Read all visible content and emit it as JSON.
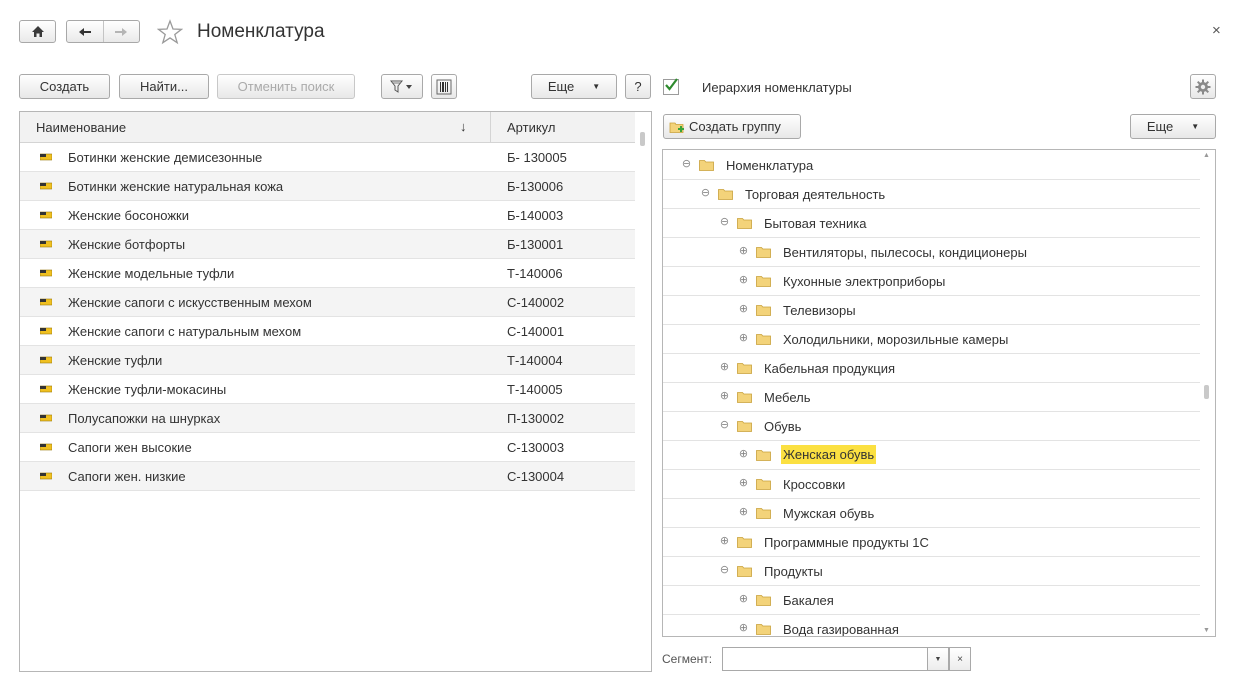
{
  "window": {
    "title": "Номенклатура",
    "close_glyph": "×"
  },
  "toolbar": {
    "create": "Создать",
    "find": "Найти...",
    "cancel_search": "Отменить поиск",
    "more": "Еще",
    "help": "?"
  },
  "list": {
    "col_name": "Наименование",
    "col_article": "Артикул",
    "sort_indicator": "↓",
    "rows": [
      {
        "name": "Ботинки женские демисезонные",
        "article": "Б- 130005"
      },
      {
        "name": "Ботинки женские натуральная кожа",
        "article": "Б-130006"
      },
      {
        "name": "Женские босоножки",
        "article": "Б-140003"
      },
      {
        "name": "Женские ботфорты",
        "article": "Б-130001"
      },
      {
        "name": "Женские модельные туфли",
        "article": "Т-140006"
      },
      {
        "name": "Женские сапоги с искусственным мехом",
        "article": "С-140002"
      },
      {
        "name": "Женские сапоги с натуральным мехом",
        "article": "С-140001"
      },
      {
        "name": "Женские туфли",
        "article": "Т-140004"
      },
      {
        "name": "Женские туфли-мокасины",
        "article": "Т-140005"
      },
      {
        "name": "Полусапожки на шнурках",
        "article": "П-130002"
      },
      {
        "name": "Сапоги жен высокие",
        "article": "С-130003"
      },
      {
        "name": "Сапоги жен. низкие",
        "article": "С-130004"
      }
    ]
  },
  "hierarchy": {
    "checkbox_label": "Иерархия номенклатуры",
    "checked": true,
    "create_group": "Создать группу",
    "more": "Еще",
    "tree": [
      {
        "label": "Номенклатура",
        "level": 0,
        "state": "expanded",
        "selected": false
      },
      {
        "label": "Торговая деятельность",
        "level": 1,
        "state": "expanded",
        "selected": false
      },
      {
        "label": "Бытовая техника",
        "level": 2,
        "state": "expanded",
        "selected": false
      },
      {
        "label": "Вентиляторы, пылесосы, кондиционеры",
        "level": 3,
        "state": "collapsed",
        "selected": false
      },
      {
        "label": "Кухонные электроприборы",
        "level": 3,
        "state": "collapsed",
        "selected": false
      },
      {
        "label": "Телевизоры",
        "level": 3,
        "state": "collapsed",
        "selected": false
      },
      {
        "label": "Холодильники, морозильные камеры",
        "level": 3,
        "state": "collapsed",
        "selected": false
      },
      {
        "label": "Кабельная продукция",
        "level": 2,
        "state": "collapsed",
        "selected": false
      },
      {
        "label": "Мебель",
        "level": 2,
        "state": "collapsed",
        "selected": false
      },
      {
        "label": "Обувь",
        "level": 2,
        "state": "expanded",
        "selected": false
      },
      {
        "label": "Женская обувь",
        "level": 3,
        "state": "collapsed",
        "selected": true
      },
      {
        "label": "Кроссовки",
        "level": 3,
        "state": "collapsed",
        "selected": false
      },
      {
        "label": "Мужская обувь",
        "level": 3,
        "state": "collapsed",
        "selected": false
      },
      {
        "label": "Программные продукты 1С",
        "level": 2,
        "state": "collapsed",
        "selected": false
      },
      {
        "label": "Продукты",
        "level": 2,
        "state": "expanded",
        "selected": false
      },
      {
        "label": "Бакалея",
        "level": 3,
        "state": "collapsed",
        "selected": false
      },
      {
        "label": "Вода газированная",
        "level": 3,
        "state": "collapsed",
        "selected": false
      }
    ]
  },
  "segment": {
    "label": "Сегмент:",
    "value": "",
    "clear_glyph": "×"
  },
  "icons": {
    "home": "home-icon",
    "back": "arrow-left-icon",
    "forward": "arrow-right-icon",
    "favorite": "star-icon",
    "filter": "filter-icon",
    "barcode": "barcode-icon",
    "settings": "gear-icon",
    "item": "item-icon",
    "folder": "folder-icon"
  },
  "colors": {
    "selection_highlight": "#fbe041",
    "check_mark": "#2e8b2e",
    "folder_yellow": "#f3d37a"
  }
}
